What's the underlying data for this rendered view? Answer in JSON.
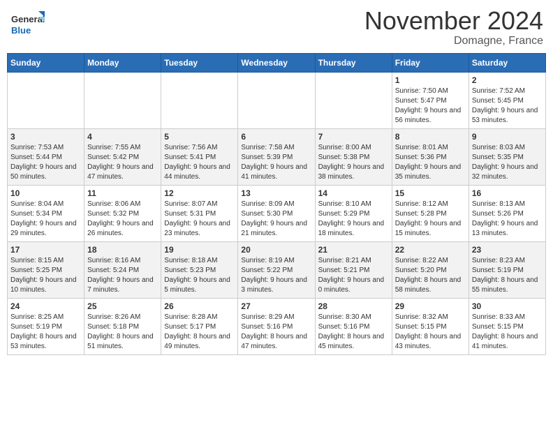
{
  "header": {
    "logo_line1": "General",
    "logo_line2": "Blue",
    "month": "November 2024",
    "location": "Domagne, France"
  },
  "weekdays": [
    "Sunday",
    "Monday",
    "Tuesday",
    "Wednesday",
    "Thursday",
    "Friday",
    "Saturday"
  ],
  "weeks": [
    [
      {
        "day": "",
        "sunrise": "",
        "sunset": "",
        "daylight": ""
      },
      {
        "day": "",
        "sunrise": "",
        "sunset": "",
        "daylight": ""
      },
      {
        "day": "",
        "sunrise": "",
        "sunset": "",
        "daylight": ""
      },
      {
        "day": "",
        "sunrise": "",
        "sunset": "",
        "daylight": ""
      },
      {
        "day": "",
        "sunrise": "",
        "sunset": "",
        "daylight": ""
      },
      {
        "day": "1",
        "sunrise": "Sunrise: 7:50 AM",
        "sunset": "Sunset: 5:47 PM",
        "daylight": "Daylight: 9 hours and 56 minutes."
      },
      {
        "day": "2",
        "sunrise": "Sunrise: 7:52 AM",
        "sunset": "Sunset: 5:45 PM",
        "daylight": "Daylight: 9 hours and 53 minutes."
      }
    ],
    [
      {
        "day": "3",
        "sunrise": "Sunrise: 7:53 AM",
        "sunset": "Sunset: 5:44 PM",
        "daylight": "Daylight: 9 hours and 50 minutes."
      },
      {
        "day": "4",
        "sunrise": "Sunrise: 7:55 AM",
        "sunset": "Sunset: 5:42 PM",
        "daylight": "Daylight: 9 hours and 47 minutes."
      },
      {
        "day": "5",
        "sunrise": "Sunrise: 7:56 AM",
        "sunset": "Sunset: 5:41 PM",
        "daylight": "Daylight: 9 hours and 44 minutes."
      },
      {
        "day": "6",
        "sunrise": "Sunrise: 7:58 AM",
        "sunset": "Sunset: 5:39 PM",
        "daylight": "Daylight: 9 hours and 41 minutes."
      },
      {
        "day": "7",
        "sunrise": "Sunrise: 8:00 AM",
        "sunset": "Sunset: 5:38 PM",
        "daylight": "Daylight: 9 hours and 38 minutes."
      },
      {
        "day": "8",
        "sunrise": "Sunrise: 8:01 AM",
        "sunset": "Sunset: 5:36 PM",
        "daylight": "Daylight: 9 hours and 35 minutes."
      },
      {
        "day": "9",
        "sunrise": "Sunrise: 8:03 AM",
        "sunset": "Sunset: 5:35 PM",
        "daylight": "Daylight: 9 hours and 32 minutes."
      }
    ],
    [
      {
        "day": "10",
        "sunrise": "Sunrise: 8:04 AM",
        "sunset": "Sunset: 5:34 PM",
        "daylight": "Daylight: 9 hours and 29 minutes."
      },
      {
        "day": "11",
        "sunrise": "Sunrise: 8:06 AM",
        "sunset": "Sunset: 5:32 PM",
        "daylight": "Daylight: 9 hours and 26 minutes."
      },
      {
        "day": "12",
        "sunrise": "Sunrise: 8:07 AM",
        "sunset": "Sunset: 5:31 PM",
        "daylight": "Daylight: 9 hours and 23 minutes."
      },
      {
        "day": "13",
        "sunrise": "Sunrise: 8:09 AM",
        "sunset": "Sunset: 5:30 PM",
        "daylight": "Daylight: 9 hours and 21 minutes."
      },
      {
        "day": "14",
        "sunrise": "Sunrise: 8:10 AM",
        "sunset": "Sunset: 5:29 PM",
        "daylight": "Daylight: 9 hours and 18 minutes."
      },
      {
        "day": "15",
        "sunrise": "Sunrise: 8:12 AM",
        "sunset": "Sunset: 5:28 PM",
        "daylight": "Daylight: 9 hours and 15 minutes."
      },
      {
        "day": "16",
        "sunrise": "Sunrise: 8:13 AM",
        "sunset": "Sunset: 5:26 PM",
        "daylight": "Daylight: 9 hours and 13 minutes."
      }
    ],
    [
      {
        "day": "17",
        "sunrise": "Sunrise: 8:15 AM",
        "sunset": "Sunset: 5:25 PM",
        "daylight": "Daylight: 9 hours and 10 minutes."
      },
      {
        "day": "18",
        "sunrise": "Sunrise: 8:16 AM",
        "sunset": "Sunset: 5:24 PM",
        "daylight": "Daylight: 9 hours and 7 minutes."
      },
      {
        "day": "19",
        "sunrise": "Sunrise: 8:18 AM",
        "sunset": "Sunset: 5:23 PM",
        "daylight": "Daylight: 9 hours and 5 minutes."
      },
      {
        "day": "20",
        "sunrise": "Sunrise: 8:19 AM",
        "sunset": "Sunset: 5:22 PM",
        "daylight": "Daylight: 9 hours and 3 minutes."
      },
      {
        "day": "21",
        "sunrise": "Sunrise: 8:21 AM",
        "sunset": "Sunset: 5:21 PM",
        "daylight": "Daylight: 9 hours and 0 minutes."
      },
      {
        "day": "22",
        "sunrise": "Sunrise: 8:22 AM",
        "sunset": "Sunset: 5:20 PM",
        "daylight": "Daylight: 8 hours and 58 minutes."
      },
      {
        "day": "23",
        "sunrise": "Sunrise: 8:23 AM",
        "sunset": "Sunset: 5:19 PM",
        "daylight": "Daylight: 8 hours and 55 minutes."
      }
    ],
    [
      {
        "day": "24",
        "sunrise": "Sunrise: 8:25 AM",
        "sunset": "Sunset: 5:19 PM",
        "daylight": "Daylight: 8 hours and 53 minutes."
      },
      {
        "day": "25",
        "sunrise": "Sunrise: 8:26 AM",
        "sunset": "Sunset: 5:18 PM",
        "daylight": "Daylight: 8 hours and 51 minutes."
      },
      {
        "day": "26",
        "sunrise": "Sunrise: 8:28 AM",
        "sunset": "Sunset: 5:17 PM",
        "daylight": "Daylight: 8 hours and 49 minutes."
      },
      {
        "day": "27",
        "sunrise": "Sunrise: 8:29 AM",
        "sunset": "Sunset: 5:16 PM",
        "daylight": "Daylight: 8 hours and 47 minutes."
      },
      {
        "day": "28",
        "sunrise": "Sunrise: 8:30 AM",
        "sunset": "Sunset: 5:16 PM",
        "daylight": "Daylight: 8 hours and 45 minutes."
      },
      {
        "day": "29",
        "sunrise": "Sunrise: 8:32 AM",
        "sunset": "Sunset: 5:15 PM",
        "daylight": "Daylight: 8 hours and 43 minutes."
      },
      {
        "day": "30",
        "sunrise": "Sunrise: 8:33 AM",
        "sunset": "Sunset: 5:15 PM",
        "daylight": "Daylight: 8 hours and 41 minutes."
      }
    ]
  ]
}
